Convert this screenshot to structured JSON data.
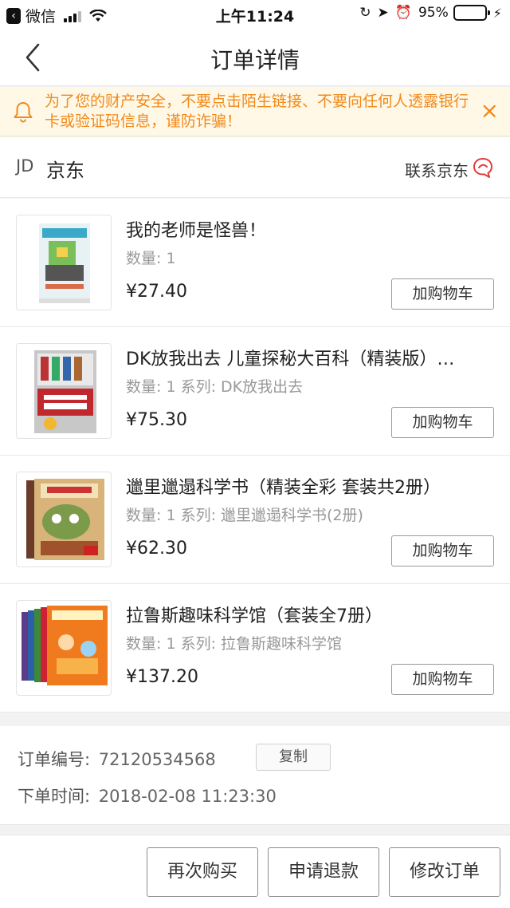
{
  "status_bar": {
    "back_app": "微信",
    "time": "上午11:24",
    "battery_text": "95%",
    "battery_level": 0.95,
    "icons": [
      "signal-icon",
      "wifi-icon",
      "rotation-lock-icon",
      "location-icon",
      "alarm-icon",
      "battery-icon",
      "charging-icon"
    ]
  },
  "nav": {
    "title": "订单详情"
  },
  "notice": {
    "text": "为了您的财产安全，不要点击陌生链接、不要向任何人透露银行卡或验证码信息，谨防诈骗！",
    "close": "×"
  },
  "shop": {
    "logo": "JD",
    "name": "京东",
    "contact_label": "联系京东"
  },
  "products": [
    {
      "title": "我的老师是怪兽！",
      "meta": "数量: 1",
      "price": "¥27.40",
      "button": "加购物车"
    },
    {
      "title": "DK放我出去 儿童探秘大百科（精装版）…",
      "meta": "数量: 1 系列: DK放我出去",
      "price": "¥75.30",
      "button": "加购物车"
    },
    {
      "title": "邋里邋遢科学书（精装全彩 套装共2册）",
      "meta": "数量: 1 系列: 邋里邋遢科学书(2册)",
      "price": "¥62.30",
      "button": "加购物车"
    },
    {
      "title": "拉鲁斯趣味科学馆（套装全7册）",
      "meta": "数量: 1 系列: 拉鲁斯趣味科学馆",
      "price": "¥137.20",
      "button": "加购物车"
    }
  ],
  "order": {
    "number_label": "订单编号:",
    "number": "72120534568",
    "copy_label": "复制",
    "time_label": "下单时间:",
    "time": "2018-02-08 11:23:30"
  },
  "actions": {
    "buy_again": "再次购买",
    "refund": "申请退款",
    "modify": "修改订单"
  },
  "colors": {
    "accent": "#f08a1c",
    "notice_bg": "#fff8e6",
    "contact_icon": "#e4393c",
    "battery": "#4cd964"
  }
}
